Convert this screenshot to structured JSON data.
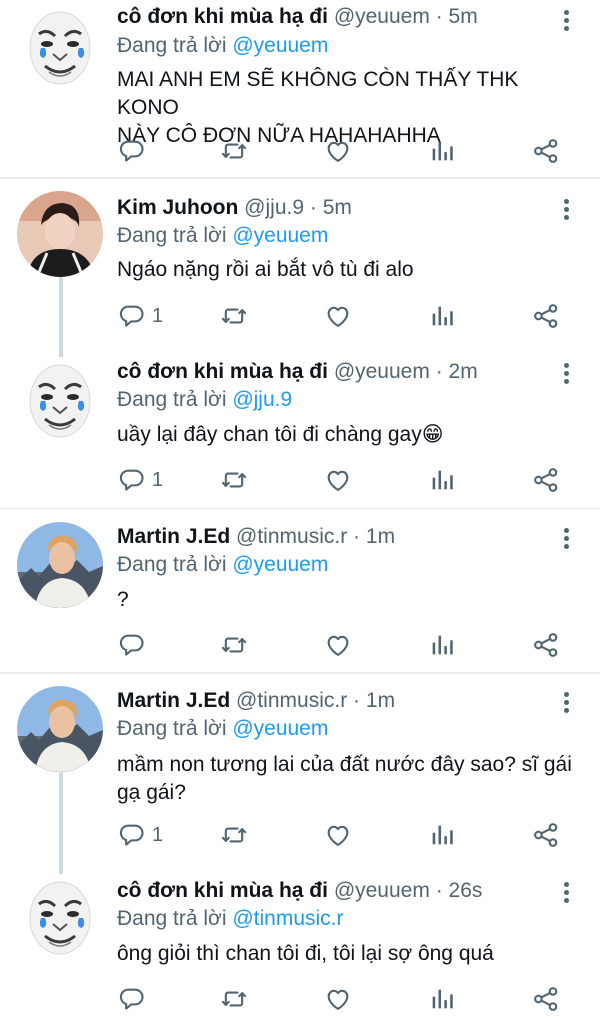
{
  "reply_prefix": "Đang trả lời",
  "tweets": [
    {
      "name": "cô đơn khi mùa hạ đi",
      "handle": "@yeuuem",
      "time": "5m",
      "reply_to": "@yeuuem",
      "text_lines": [
        "MAI ANH EM SẼ KHÔNG CÒN THẤY THK KONO",
        "NÀY CÔ ĐƠN NỮA HAHAHAHHA"
      ],
      "reply_count": ""
    },
    {
      "name": "Kim Juhoon",
      "handle": "@jju.9",
      "time": "5m",
      "reply_to": "@yeuuem",
      "text_lines": [
        "Ngáo nặng rồi ai bắt vô tù đi alo"
      ],
      "reply_count": "1"
    },
    {
      "name": "cô đơn khi mùa hạ đi",
      "handle": "@yeuuem",
      "time": "2m",
      "reply_to": "@jju.9",
      "text_lines": [
        "uầy lại đây chan tôi đi chàng gay😁"
      ],
      "reply_count": "1"
    },
    {
      "name": "Martin J.Ed",
      "handle": "@tinmusic.r",
      "time": "1m",
      "reply_to": "@yeuuem",
      "text_lines": [
        "?"
      ],
      "reply_count": ""
    },
    {
      "name": "Martin J.Ed",
      "handle": "@tinmusic.r",
      "time": "1m",
      "reply_to": "@yeuuem",
      "text_lines": [
        "mầm non tương lai của đất nước đây sao? sĩ gái",
        "gạ gái?"
      ],
      "reply_count": "1"
    },
    {
      "name": "cô đơn khi mùa hạ đi",
      "handle": "@yeuuem",
      "time": "26s",
      "reply_to": "@tinmusic.r",
      "text_lines": [
        "ông giỏi thì chan tôi đi, tôi lại sợ ông quá"
      ],
      "reply_count": ""
    }
  ],
  "icons": {
    "reply": "reply-icon",
    "retweet": "retweet-icon",
    "like": "heart-icon",
    "stats": "stats-icon",
    "share": "share-icon",
    "more": "more-vertical-icon"
  },
  "colors": {
    "link": "#1d9bf0",
    "muted": "#536471",
    "thread_line": "#cfd9de",
    "separator": "#e6ecf0"
  }
}
